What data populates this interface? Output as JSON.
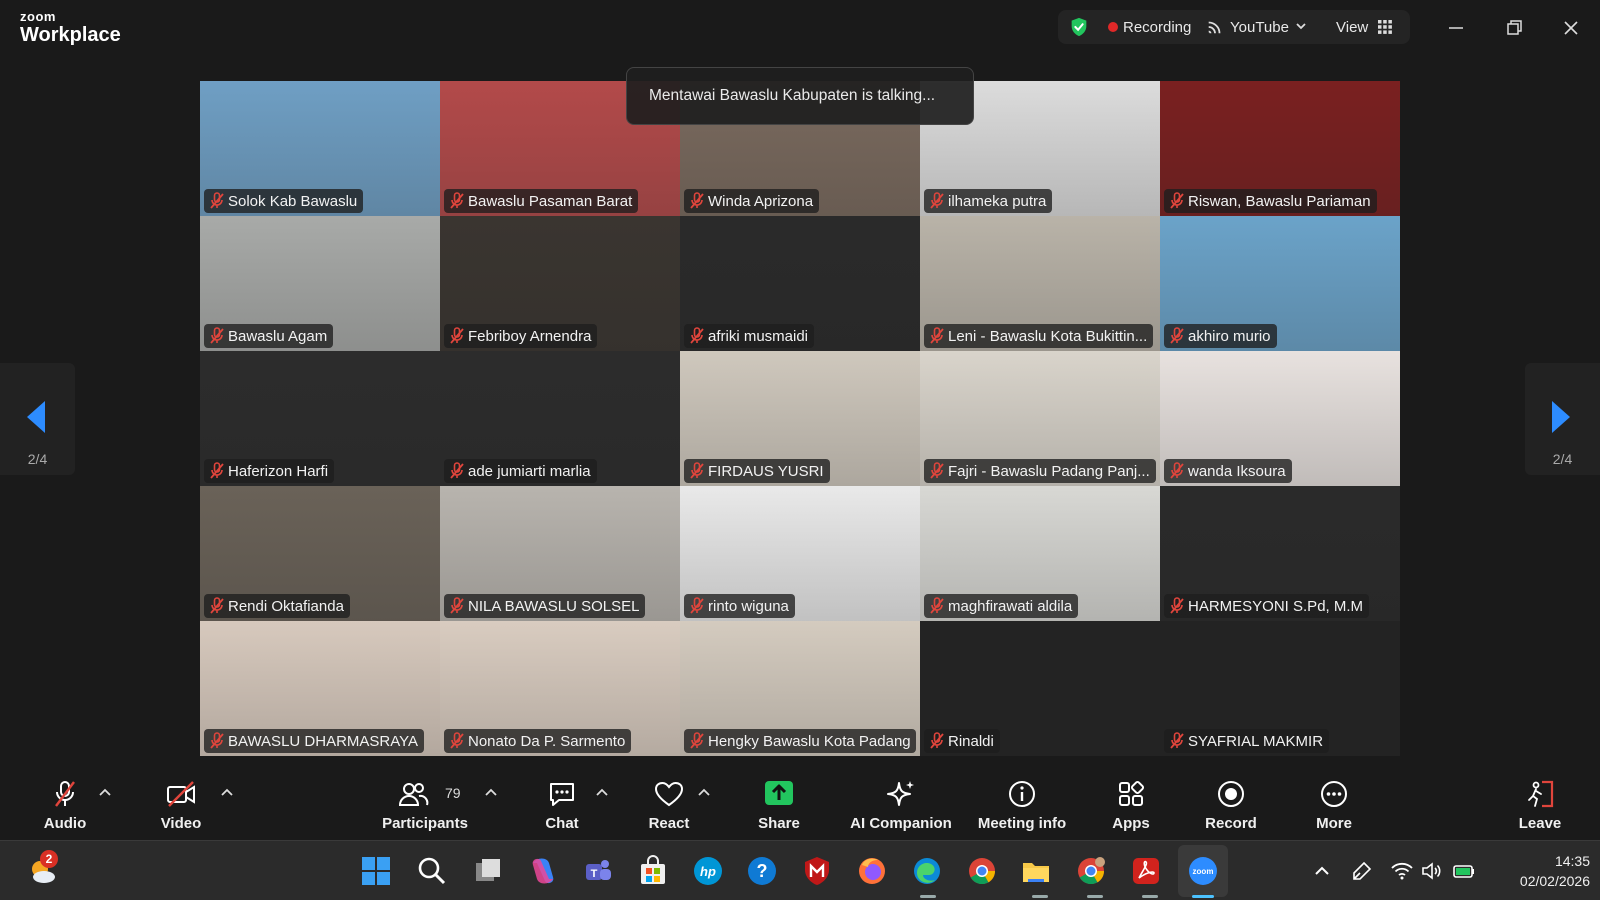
{
  "app": {
    "brand_top": "zoom",
    "brand_bottom": "Workplace"
  },
  "status": {
    "recording": "Recording",
    "stream": "YouTube",
    "view": "View"
  },
  "talking": "Mentawai Bawaslu Kabupaten is talking...",
  "pagination": {
    "left": "2/4",
    "right": "2/4"
  },
  "participants": [
    {
      "name": "Solok Kab Bawaslu",
      "bg": "#6f9fc4"
    },
    {
      "name": "Bawaslu Pasaman Barat",
      "bg": "#b34a4a"
    },
    {
      "name": "Winda Aprizona",
      "bg": "#7a6a5e"
    },
    {
      "name": "ilhameka putra",
      "bg": "#dcdcdc"
    },
    {
      "name": "Riswan, Bawaslu Pariaman",
      "bg": "#7a2020"
    },
    {
      "name": "Bawaslu Agam",
      "bg": "#a8aaa8"
    },
    {
      "name": "Febriboy Arnendra",
      "bg": "#3a3530"
    },
    {
      "name": "afriki musmaidi",
      "bg": "#2a2a2a"
    },
    {
      "name": "Leni - Bawaslu Kota Bukittin...",
      "bg": "#b9b3a8"
    },
    {
      "name": "akhiro murio",
      "bg": "#6ba3c9"
    },
    {
      "name": "Haferizon Harfi",
      "bg": "#2c2c2c"
    },
    {
      "name": "ade jumiarti marlia",
      "bg": "#2c2c2c"
    },
    {
      "name": "FIRDAUS YUSRI",
      "bg": "#cfc8bd"
    },
    {
      "name": "Fajri - Bawaslu Padang Panj...",
      "bg": "#d9d4cb"
    },
    {
      "name": "wanda Iksoura",
      "bg": "#e8e2df"
    },
    {
      "name": "Rendi Oktafianda",
      "bg": "#6a6258"
    },
    {
      "name": "NILA BAWASLU SOLSEL",
      "bg": "#b8b4ae"
    },
    {
      "name": "rinto wiguna",
      "bg": "#e9e9e9"
    },
    {
      "name": "maghfirawati aldila",
      "bg": "#d8d8d4"
    },
    {
      "name": "HARMESYONI S.Pd, M.M",
      "bg": "#2a2a2a"
    },
    {
      "name": "BAWASLU DHARMASRAYA",
      "bg": "#d7c9bd"
    },
    {
      "name": "Nonato Da P. Sarmento",
      "bg": "#d9ccc0"
    },
    {
      "name": "Hengky Bawaslu Kota Padang",
      "bg": "#d4cbbf"
    },
    {
      "name": "Rinaldi",
      "bg": "#232323"
    },
    {
      "name": "SYAFRIAL MAKMIR",
      "bg": "#232323"
    }
  ],
  "toolbar": {
    "audio": "Audio",
    "video": "Video",
    "participants": "Participants",
    "participant_count": "79",
    "chat": "Chat",
    "react": "React",
    "share": "Share",
    "ai_companion": "AI Companion",
    "meeting_info": "Meeting info",
    "apps": "Apps",
    "record": "Record",
    "more": "More",
    "leave": "Leave"
  },
  "taskbar": {
    "weather_badge": "2",
    "time": "14:35",
    "date": "02/02/2026"
  },
  "colors": {
    "mute_red": "#e0453c",
    "share_green": "#22c55e",
    "accent_blue": "#2d8cff"
  }
}
